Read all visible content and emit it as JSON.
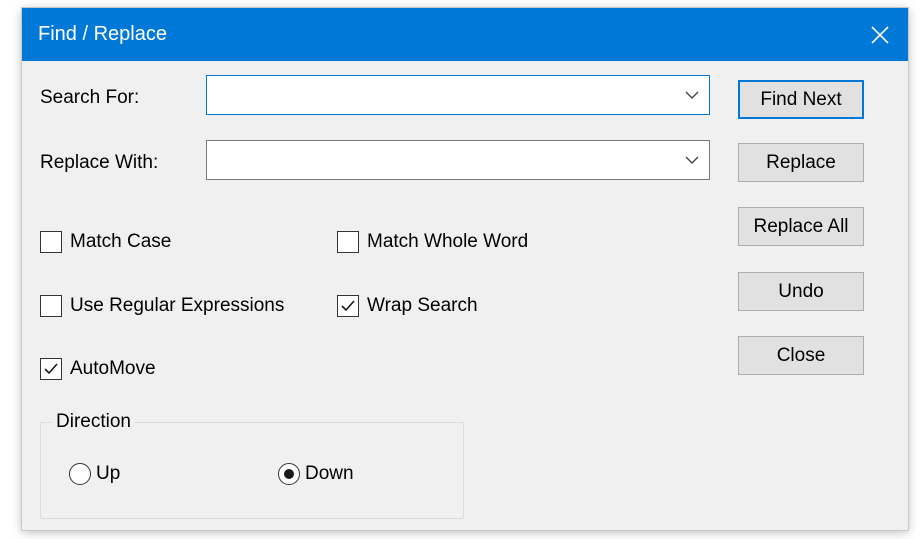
{
  "window": {
    "title": "Find / Replace"
  },
  "fields": {
    "search_label": "Search For:",
    "search_value": "",
    "replace_label": "Replace With:",
    "replace_value": ""
  },
  "options": {
    "match_case": {
      "label": "Match Case",
      "checked": false
    },
    "match_whole_word": {
      "label": "Match Whole Word",
      "checked": false
    },
    "use_regex": {
      "label": "Use Regular Expressions",
      "checked": false
    },
    "wrap_search": {
      "label": "Wrap Search",
      "checked": true
    },
    "auto_move": {
      "label": "AutoMove",
      "checked": true
    }
  },
  "direction": {
    "label": "Direction",
    "up": {
      "label": "Up",
      "selected": false
    },
    "down": {
      "label": "Down",
      "selected": true
    }
  },
  "buttons": {
    "find_next": "Find Next",
    "replace": "Replace",
    "replace_all": "Replace All",
    "undo": "Undo",
    "close": "Close"
  },
  "colors": {
    "titlebar": "#0078d7",
    "window_bg": "#f0f0f0",
    "button_bg": "#e1e1e1",
    "focus_border": "#0078d7"
  },
  "icons": {
    "close": "close-icon",
    "dropdown": "chevron-down-icon",
    "check": "checkmark-icon"
  }
}
